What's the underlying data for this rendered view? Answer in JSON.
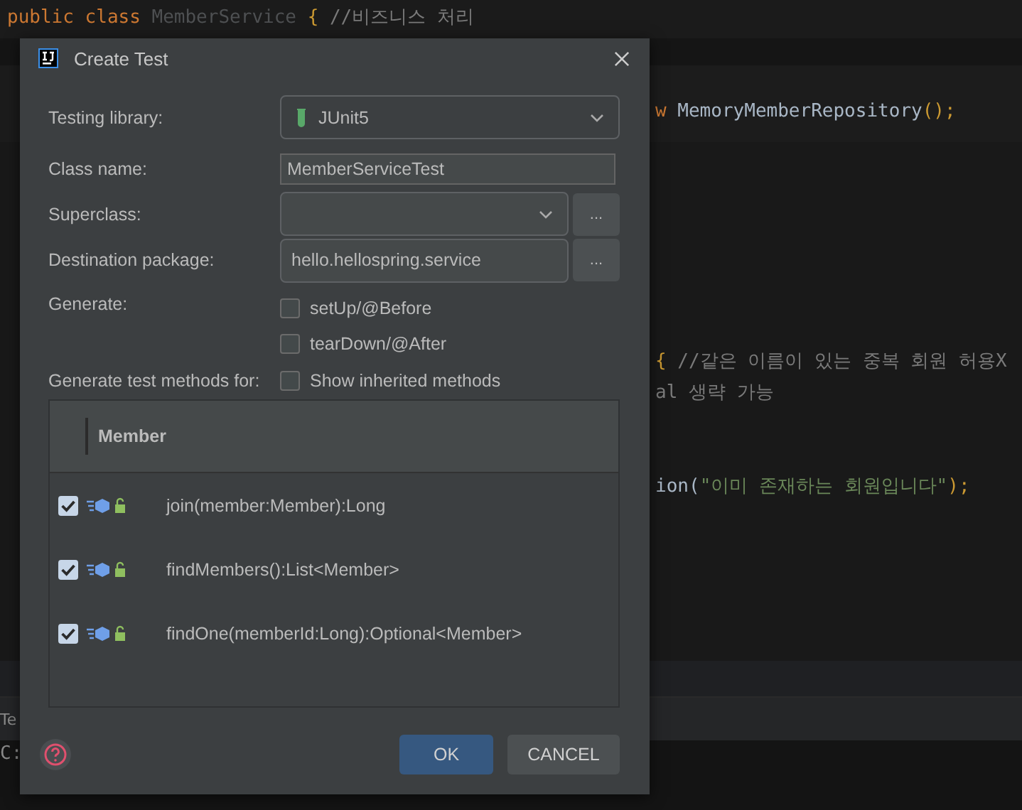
{
  "editor": {
    "lines": [
      {
        "tokens": [
          {
            "text": "public class ",
            "kind": "keyword"
          },
          {
            "text": "MemberService ",
            "kind": "dim"
          },
          {
            "text": "{ ",
            "kind": "brace"
          },
          {
            "text": "//비즈니스 처리",
            "kind": "comment"
          }
        ]
      },
      {
        "tokens": [
          {
            "text": "w ",
            "kind": "keyword"
          },
          {
            "text": "MemoryMemberRepository",
            "kind": "plain"
          },
          {
            "text": "();",
            "kind": "brace"
          }
        ]
      },
      {
        "tokens": [
          {
            "text": "{ ",
            "kind": "brace"
          },
          {
            "text": "//같은 이름이 있는 중복 회원 허용X",
            "kind": "comment"
          }
        ]
      },
      {
        "tokens": [
          {
            "text": "al 생략 가능",
            "kind": "comment"
          }
        ]
      },
      {
        "tokens": [
          {
            "text": "ion(",
            "kind": "plain"
          },
          {
            "text": "\"이미 존재하는 회원입니다\"",
            "kind": "string"
          },
          {
            "text": ");",
            "kind": "brace"
          }
        ]
      }
    ]
  },
  "bottom_panel": {
    "lines": [
      "Te",
      "C:"
    ]
  },
  "dialog": {
    "title": "Create Test",
    "fields": [
      {
        "kind": "select",
        "label": "Testing library:",
        "value": "JUnit5"
      },
      {
        "kind": "text",
        "label": "Class name:",
        "value": "MemberServiceTest"
      },
      {
        "kind": "select_browse",
        "label": "Superclass:",
        "browse": "..."
      },
      {
        "kind": "text_browse",
        "label": "Destination package:",
        "value": "hello.hellospring.service",
        "browse": "..."
      }
    ],
    "generate": {
      "label": "Generate:",
      "options": [
        {
          "label": "setUp/@Before",
          "checked": false
        },
        {
          "label": "tearDown/@After",
          "checked": false
        }
      ]
    },
    "methods": {
      "label": "Generate test methods for:",
      "show_inherited": {
        "label": "Show inherited methods",
        "checked": false
      },
      "header": "Member",
      "items": [
        {
          "signature": "join(member:Member):Long",
          "checked": true
        },
        {
          "signature": "findMembers():List<Member>",
          "checked": true
        },
        {
          "signature": "findOne(memberId:Long):Optional<Member>",
          "checked": true
        }
      ]
    },
    "buttons": [
      {
        "label": "OK",
        "kind": "primary"
      },
      {
        "label": "CANCEL",
        "kind": "secondary"
      }
    ]
  }
}
